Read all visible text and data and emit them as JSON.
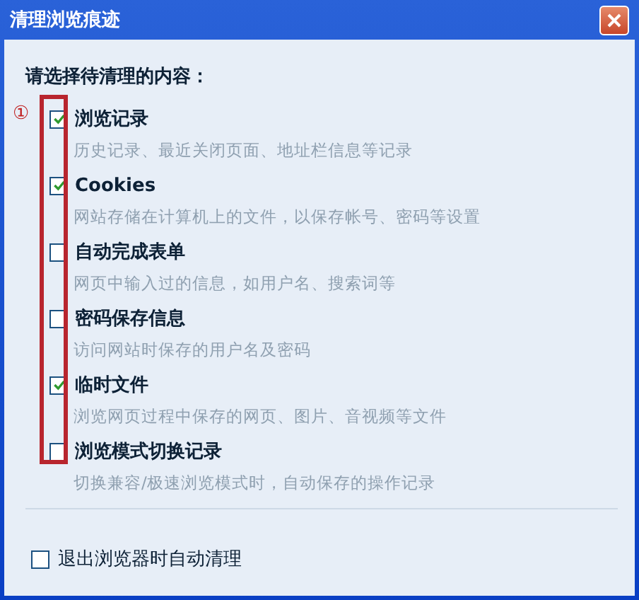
{
  "window": {
    "title": "清理浏览痕迹"
  },
  "heading": "请选择待清理的内容：",
  "annotation": {
    "label": "①"
  },
  "options": [
    {
      "label": "浏览记录",
      "description": "历史记录、最近关闭页面、地址栏信息等记录",
      "checked": true
    },
    {
      "label": "Cookies",
      "description": "网站存储在计算机上的文件，以保存帐号、密码等设置",
      "checked": true
    },
    {
      "label": "自动完成表单",
      "description": "网页中输入过的信息，如用户名、搜索词等",
      "checked": false
    },
    {
      "label": "密码保存信息",
      "description": "访问网站时保存的用户名及密码",
      "checked": false
    },
    {
      "label": "临时文件",
      "description": "浏览网页过程中保存的网页、图片、音视频等文件",
      "checked": true
    },
    {
      "label": "浏览模式切换记录",
      "description": "切换兼容/极速浏览模式时，自动保存的操作记录",
      "checked": false
    }
  ],
  "auto_clean": {
    "label": "退出浏览器时自动清理",
    "checked": false
  }
}
